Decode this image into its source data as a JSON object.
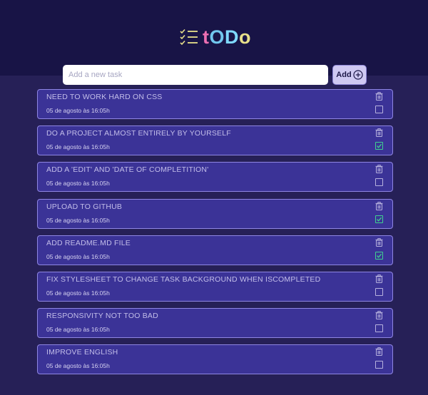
{
  "app": {
    "title_letters": [
      "t",
      "O",
      "D",
      "o"
    ],
    "brand_icon": "checklist-icon"
  },
  "new_task": {
    "placeholder": "Add a new task",
    "value": ""
  },
  "add_button": {
    "label": "Add",
    "icon": "plus-circle-icon"
  },
  "colors": {
    "header_bg": "#181446",
    "body_bg": "#262057",
    "card_bg": "#3b3397",
    "card_border": "#8f86e3",
    "done_check": "#3fd18f"
  },
  "tasks": [
    {
      "title": "NEED TO WORK HARD ON CSS",
      "date": "05 de agosto às 16:05h",
      "completed": false
    },
    {
      "title": "DO A PROJECT ALMOST ENTIRELY BY YOURSELF",
      "date": "05 de agosto às 16:05h",
      "completed": true
    },
    {
      "title": "ADD A 'EDIT' AND 'DATE OF COMPLETITION'",
      "date": "05 de agosto às 16:05h",
      "completed": false
    },
    {
      "title": "UPLOAD TO GITHUB",
      "date": "05 de agosto às 16:05h",
      "completed": true
    },
    {
      "title": "ADD README.MD FILE",
      "date": "05 de agosto às 16:05h",
      "completed": true
    },
    {
      "title": "FIX STYLESHEET TO CHANGE TASK BACKGROUND WHEN ISCOMPLETED",
      "date": "05 de agosto às 16:05h",
      "completed": false
    },
    {
      "title": "RESPONSIVITY NOT TOO BAD",
      "date": "05 de agosto às 16:05h",
      "completed": false
    },
    {
      "title": "IMPROVE ENGLISH",
      "date": "05 de agosto às 16:05h",
      "completed": false
    }
  ]
}
